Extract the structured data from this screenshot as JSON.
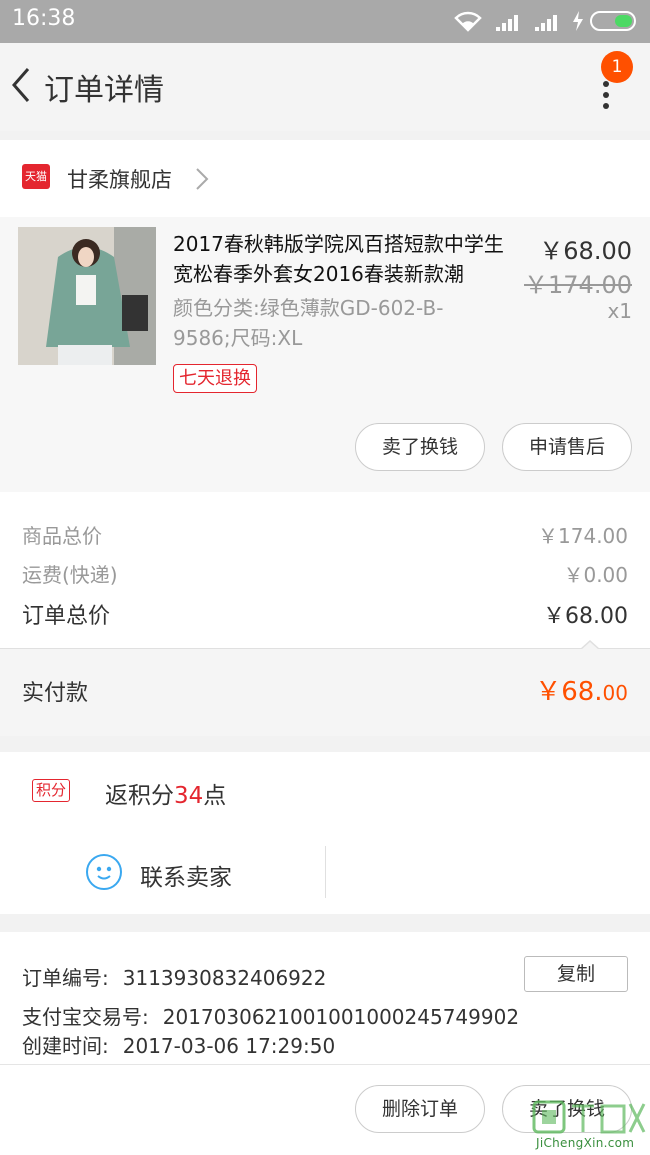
{
  "status_bar": {
    "time": "16:38"
  },
  "nav": {
    "title": "订单详情",
    "badge_count": "1"
  },
  "store": {
    "icon_label": "天猫",
    "name": "甘柔旗舰店"
  },
  "product": {
    "title": "2017春秋韩版学院风百搭短款中学生宽松春季外套女2016春装新款潮",
    "spec": "颜色分类:绿色薄款GD-602-B-9586;尺码:XL",
    "return_tag": "七天退换",
    "price_now": "￥68.00",
    "price_old": "￥174.00",
    "quantity": "x1",
    "sell_button": "卖了换钱",
    "after_sale_button": "申请售后"
  },
  "summary": {
    "goods_total_label": "商品总价",
    "goods_total_value": "￥174.00",
    "shipping_label": "运费(快递)",
    "shipping_value": "￥0.00",
    "order_total_label": "订单总价",
    "order_total_value": "￥68.00",
    "paid_label": "实付款",
    "paid_main": "￥68.",
    "paid_cents": "00"
  },
  "points": {
    "tag": "积分",
    "prefix": "返积分",
    "amount": "34",
    "suffix": "点"
  },
  "contact": {
    "label": "联系卖家"
  },
  "order_info": {
    "order_no_label": "订单编号:",
    "order_no_value": "3113930832406922",
    "copy_button": "复制",
    "alipay_label": "支付宝交易号:",
    "alipay_value": "2017030621001001000245749902",
    "created_label": "创建时间:",
    "created_value": "2017-03-06 17:29:50"
  },
  "bottom_bar": {
    "delete_button": "删除订单",
    "sell_button": "卖了换钱"
  },
  "watermark": {
    "text": "JiChengXin.com"
  },
  "colors": {
    "accent_orange": "#ff5000",
    "tmall_red": "#e4262f",
    "contact_blue": "#3aa8f0",
    "status_bar": "#a9a9a9"
  }
}
